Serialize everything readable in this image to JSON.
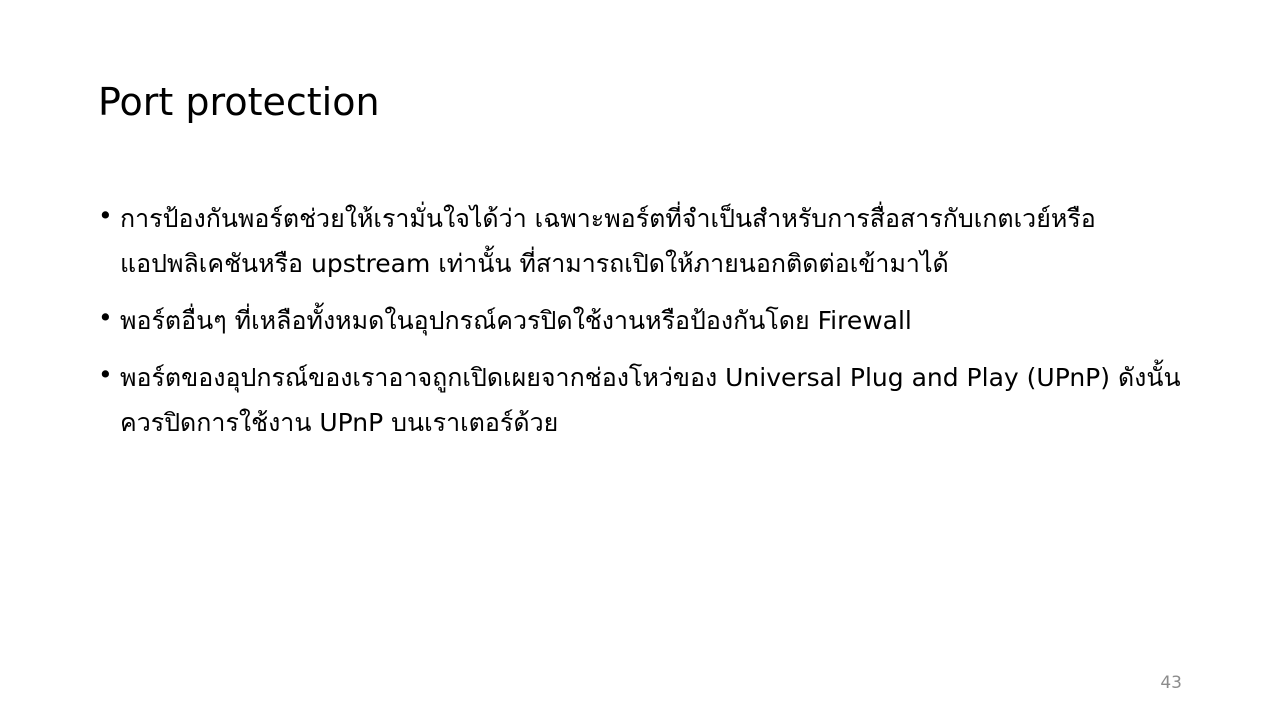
{
  "slide": {
    "title": "Port protection",
    "bullets": [
      "การป้องกันพอร์ตช่วยให้เรามั่นใจได้ว่า เฉพาะพอร์ตที่จำเป็นสำหรับการสื่อสารกับเกตเวย์หรือแอปพลิเคชันหรือ upstream เท่านั้น ที่สามารถเปิดให้ภายนอกติดต่อเข้ามาได้",
      "พอร์ตอื่นๆ ที่เหลือทั้งหมดในอุปกรณ์ควรปิดใช้งานหรือป้องกันโดย Firewall",
      "พอร์ตของอุปกรณ์ของเราอาจถูกเปิดเผยจากช่องโหว่ของ Universal Plug and Play (UPnP) ดังนั้นควรปิดการใช้งาน UPnP บนเราเตอร์ด้วย"
    ],
    "bullet_symbol": "•",
    "page_number": "43"
  }
}
